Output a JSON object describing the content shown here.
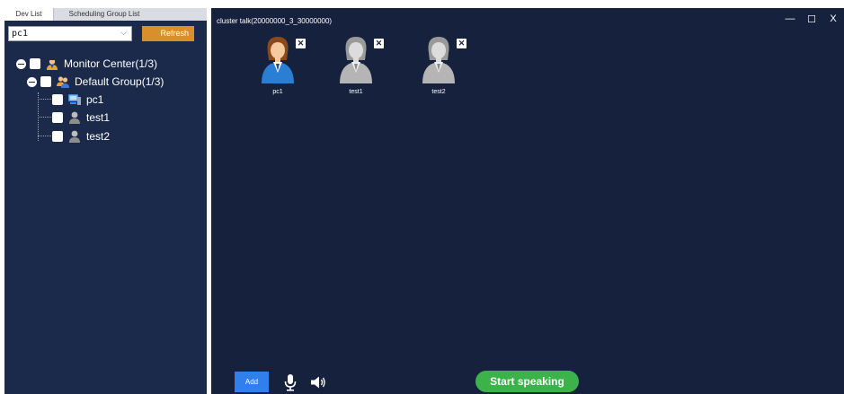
{
  "left_panel": {
    "tabs": [
      "Dev List",
      "Scheduling Group List"
    ],
    "device_select": {
      "value": "pc1",
      "chevron_icon": "chevron-down-icon"
    },
    "refresh_label": "Refresh",
    "tree": {
      "root": {
        "label": "Monitor Center(1/3)",
        "icon": "monitor-center-icon"
      },
      "group": {
        "label": "Default Group(1/3)",
        "icon": "group-users-icon"
      },
      "devices": [
        {
          "label": "pc1",
          "icon": "computer-icon",
          "online": true
        },
        {
          "label": "test1",
          "icon": "person-gray-icon",
          "online": false
        },
        {
          "label": "test2",
          "icon": "person-gray-icon",
          "online": false
        }
      ]
    }
  },
  "right_panel": {
    "title": "cluster talk(20000000_3_30000000)",
    "window_controls": {
      "minimize": "—",
      "maximize": "☐",
      "close": "X"
    },
    "members": [
      {
        "name": "pc1",
        "status": "online"
      },
      {
        "name": "test1",
        "status": "offline"
      },
      {
        "name": "test2",
        "status": "offline"
      }
    ],
    "remove_glyph": "✕",
    "add_label": "Add",
    "mic_icon": "microphone-icon",
    "speaker_icon": "speaker-icon",
    "speak_label": "Start speaking"
  },
  "colors": {
    "left_bg": "#1b2a4a",
    "right_bg": "#16213e",
    "refresh": "#d98f2b",
    "add": "#2f80ed",
    "speak": "#3cb34a"
  }
}
